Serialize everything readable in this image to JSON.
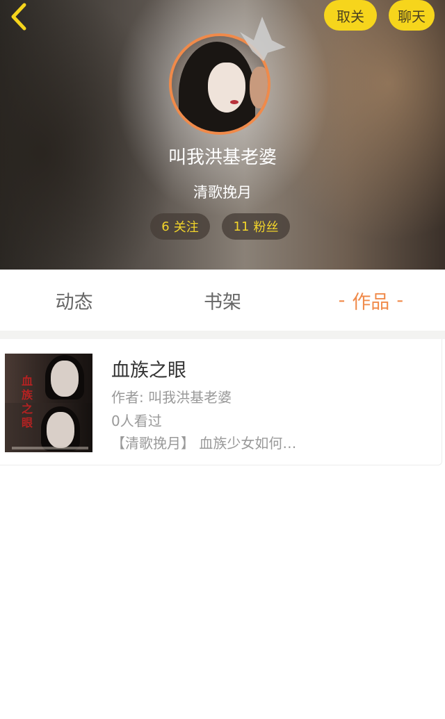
{
  "header": {
    "back_icon": "chevron-left-icon",
    "unfollow_label": "取关",
    "chat_label": "聊天",
    "nickname": "叫我洪基老婆",
    "signature": "清歌挽月",
    "following_count": "6",
    "following_label": "关注",
    "fans_count": "11",
    "fans_label": "粉丝",
    "accent_color": "#f6d51c",
    "avatar_ring_color": "#f08a4a"
  },
  "tabs": [
    {
      "label": "动态",
      "active": false
    },
    {
      "label": "书架",
      "active": false
    },
    {
      "label": "作品",
      "active": true
    }
  ],
  "works": [
    {
      "title": "血族之眼",
      "author": "作者: 叫我洪基老婆",
      "views": "0人看过",
      "description": "【清歌挽月】 血族少女如何…",
      "cover_text": "血族之眼"
    }
  ]
}
